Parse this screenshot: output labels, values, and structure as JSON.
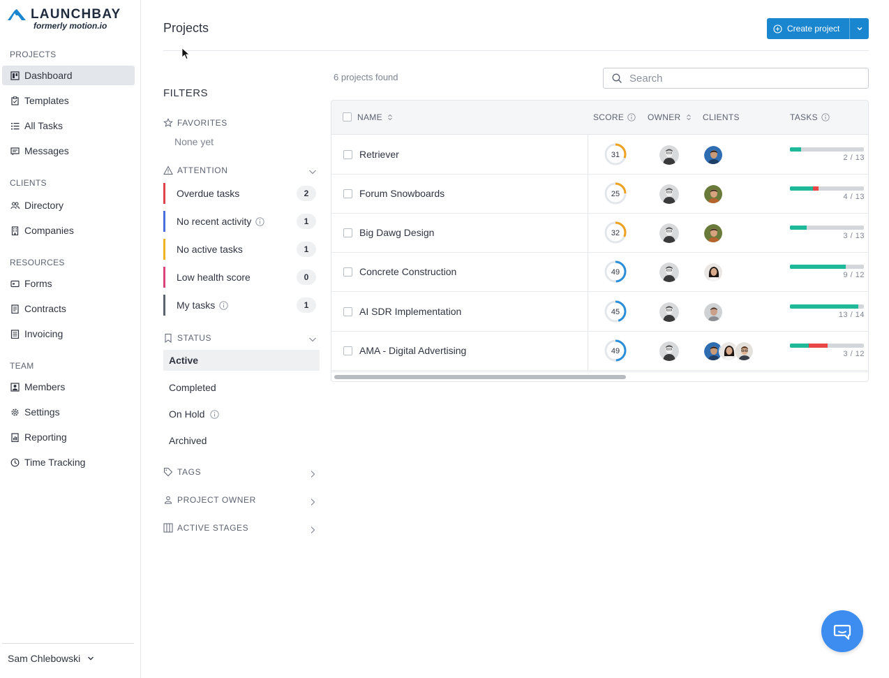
{
  "brand": {
    "name": "LAUNCHBAY",
    "subtitle": "formerly motion.io",
    "accent": "#1a86d0"
  },
  "sidebar": {
    "sections": [
      {
        "label": "PROJECTS",
        "items": [
          {
            "label": "Dashboard",
            "icon": "dashboard-icon",
            "active": true
          },
          {
            "label": "Templates",
            "icon": "clipboard-icon"
          },
          {
            "label": "All Tasks",
            "icon": "list-icon"
          },
          {
            "label": "Messages",
            "icon": "message-icon"
          }
        ]
      },
      {
        "label": "CLIENTS",
        "items": [
          {
            "label": "Directory",
            "icon": "people-icon"
          },
          {
            "label": "Companies",
            "icon": "building-icon"
          }
        ]
      },
      {
        "label": "RESOURCES",
        "items": [
          {
            "label": "Forms",
            "icon": "form-icon"
          },
          {
            "label": "Contracts",
            "icon": "document-icon"
          },
          {
            "label": "Invoicing",
            "icon": "invoice-icon"
          }
        ]
      },
      {
        "label": "TEAM",
        "items": [
          {
            "label": "Members",
            "icon": "member-icon"
          },
          {
            "label": "Settings",
            "icon": "gear-icon"
          },
          {
            "label": "Reporting",
            "icon": "report-icon"
          },
          {
            "label": "Time Tracking",
            "icon": "clock-icon"
          }
        ]
      }
    ],
    "user": "Sam Chlebowski"
  },
  "header": {
    "title": "Projects",
    "create_label": "Create project"
  },
  "filters": {
    "title": "FILTERS",
    "favorites_label": "FAVORITES",
    "favorites_empty": "None yet",
    "attention_label": "ATTENTION",
    "attention": [
      {
        "label": "Overdue tasks",
        "count": "2",
        "color": "#e0434b"
      },
      {
        "label": "No recent activity",
        "count": "1",
        "color": "#4a6fdc",
        "info": true
      },
      {
        "label": "No active tasks",
        "count": "1",
        "color": "#f0b323"
      },
      {
        "label": "Low health score",
        "count": "0",
        "color": "#d9457a"
      },
      {
        "label": "My tasks",
        "count": "1",
        "color": "#5b6270",
        "info": true
      }
    ],
    "status_label": "STATUS",
    "status": [
      {
        "label": "Active",
        "active": true
      },
      {
        "label": "Completed"
      },
      {
        "label": "On Hold",
        "info": true
      },
      {
        "label": "Archived"
      }
    ],
    "tags_label": "TAGS",
    "owner_label": "PROJECT OWNER",
    "stages_label": "ACTIVE STAGES"
  },
  "results": {
    "found_text": "6 projects found",
    "search_placeholder": "Search",
    "columns": {
      "name": "NAME",
      "score": "SCORE",
      "owner": "OWNER",
      "clients": "CLIENTS",
      "tasks": "TASKS"
    },
    "projects": [
      {
        "name": "Retriever",
        "score": 31,
        "score_color": "#f0a020",
        "clients": [
          "client-blue"
        ],
        "done": 2,
        "total": 13,
        "overdue": 0
      },
      {
        "name": "Forum Snowboards",
        "score": 25,
        "score_color": "#f0a020",
        "clients": [
          "client-green"
        ],
        "done": 4,
        "total": 13,
        "overdue": 1
      },
      {
        "name": "Big Dawg Design",
        "score": 32,
        "score_color": "#f0a020",
        "clients": [
          "client-green"
        ],
        "done": 3,
        "total": 13,
        "overdue": 0
      },
      {
        "name": "Concrete Construction",
        "score": 49,
        "score_color": "#2a8fd8",
        "clients": [
          "client-woman"
        ],
        "done": 9,
        "total": 12,
        "overdue": 0
      },
      {
        "name": "AI SDR Implementation",
        "score": 45,
        "score_color": "#2a8fd8",
        "clients": [
          "client-gray"
        ],
        "done": 13,
        "total": 14,
        "overdue": 0
      },
      {
        "name": "AMA - Digital Advertising",
        "score": 49,
        "score_color": "#2a8fd8",
        "clients": [
          "client-blue",
          "client-woman",
          "client-glasses"
        ],
        "done": 3,
        "total": 12,
        "overdue": 3
      }
    ],
    "progress_color": "#1fb99a",
    "overdue_color": "#e84545"
  }
}
